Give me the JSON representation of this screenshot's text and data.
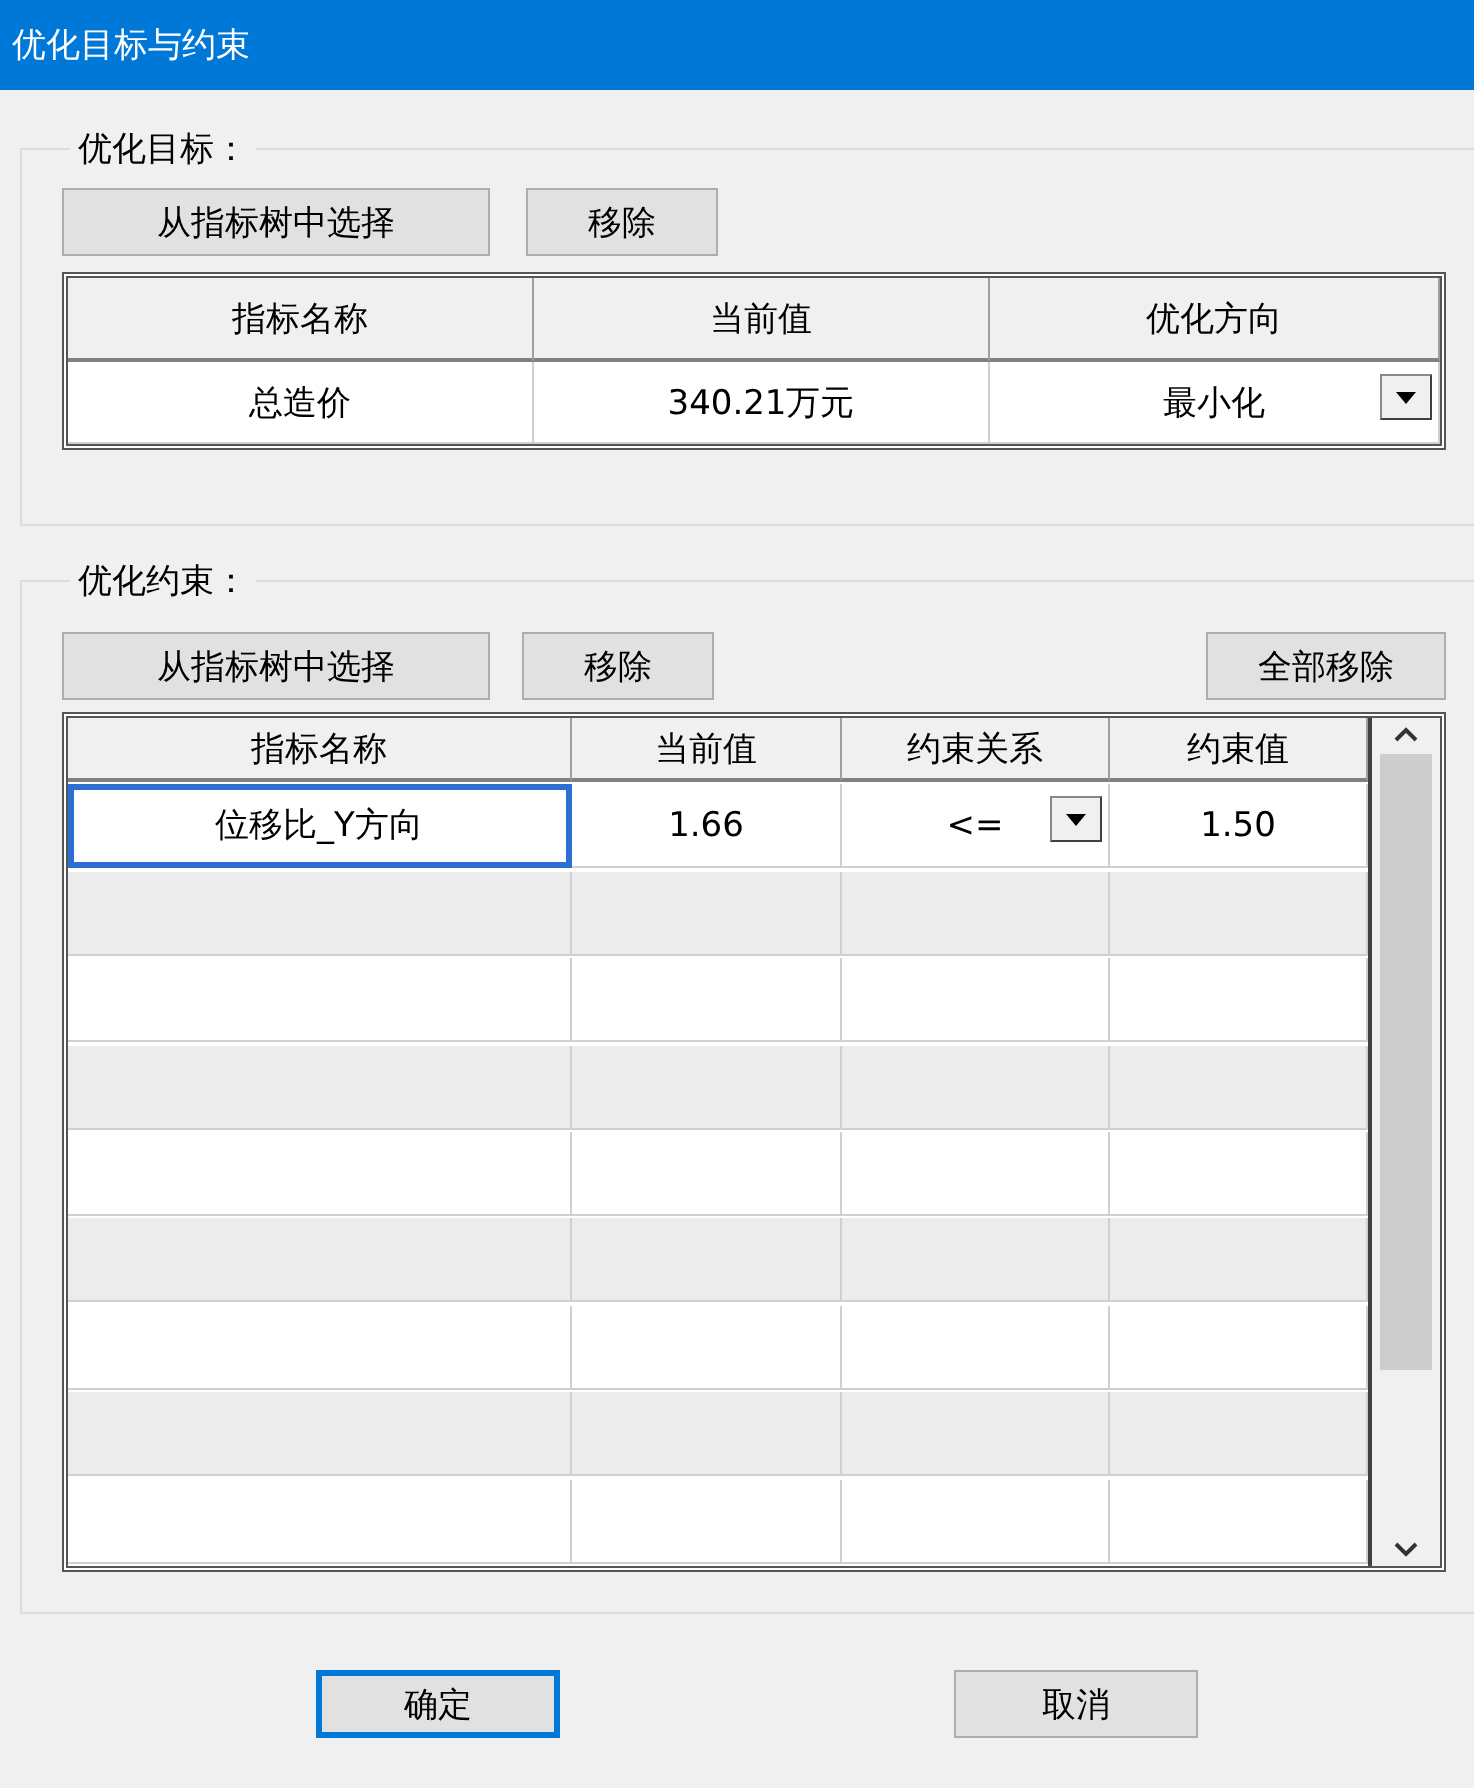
{
  "window": {
    "title": "优化目标与约束"
  },
  "objective": {
    "legend": "优化目标：",
    "buttons": [
      {
        "label": "从指标树中选择"
      },
      {
        "label": "移除"
      }
    ],
    "columns": [
      "指标名称",
      "当前值",
      "优化方向"
    ],
    "rows": [
      {
        "cells": [
          {
            "kind": "text",
            "text": "总造价",
            "focused": false
          },
          {
            "kind": "text",
            "text": "340.21万元",
            "focused": false
          },
          {
            "kind": "dropdown",
            "text": "最小化",
            "focused": false
          }
        ]
      }
    ]
  },
  "constraints": {
    "legend": "优化约束：",
    "buttons": [
      {
        "label": "从指标树中选择"
      },
      {
        "label": "移除"
      }
    ],
    "remove_all_button": "全部移除",
    "columns": [
      "指标名称",
      "当前值",
      "约束关系",
      "约束值"
    ],
    "rows": [
      {
        "cells": [
          {
            "kind": "text",
            "text": "位移比_Y方向",
            "focused": true
          },
          {
            "kind": "text",
            "text": "1.66",
            "focused": false
          },
          {
            "kind": "dropdown",
            "text": "<=",
            "focused": false
          },
          {
            "kind": "text",
            "text": "1.50",
            "focused": false
          }
        ]
      }
    ]
  },
  "footer": [
    {
      "label": "确定",
      "focused": true
    },
    {
      "label": "取消",
      "focused": false
    }
  ]
}
